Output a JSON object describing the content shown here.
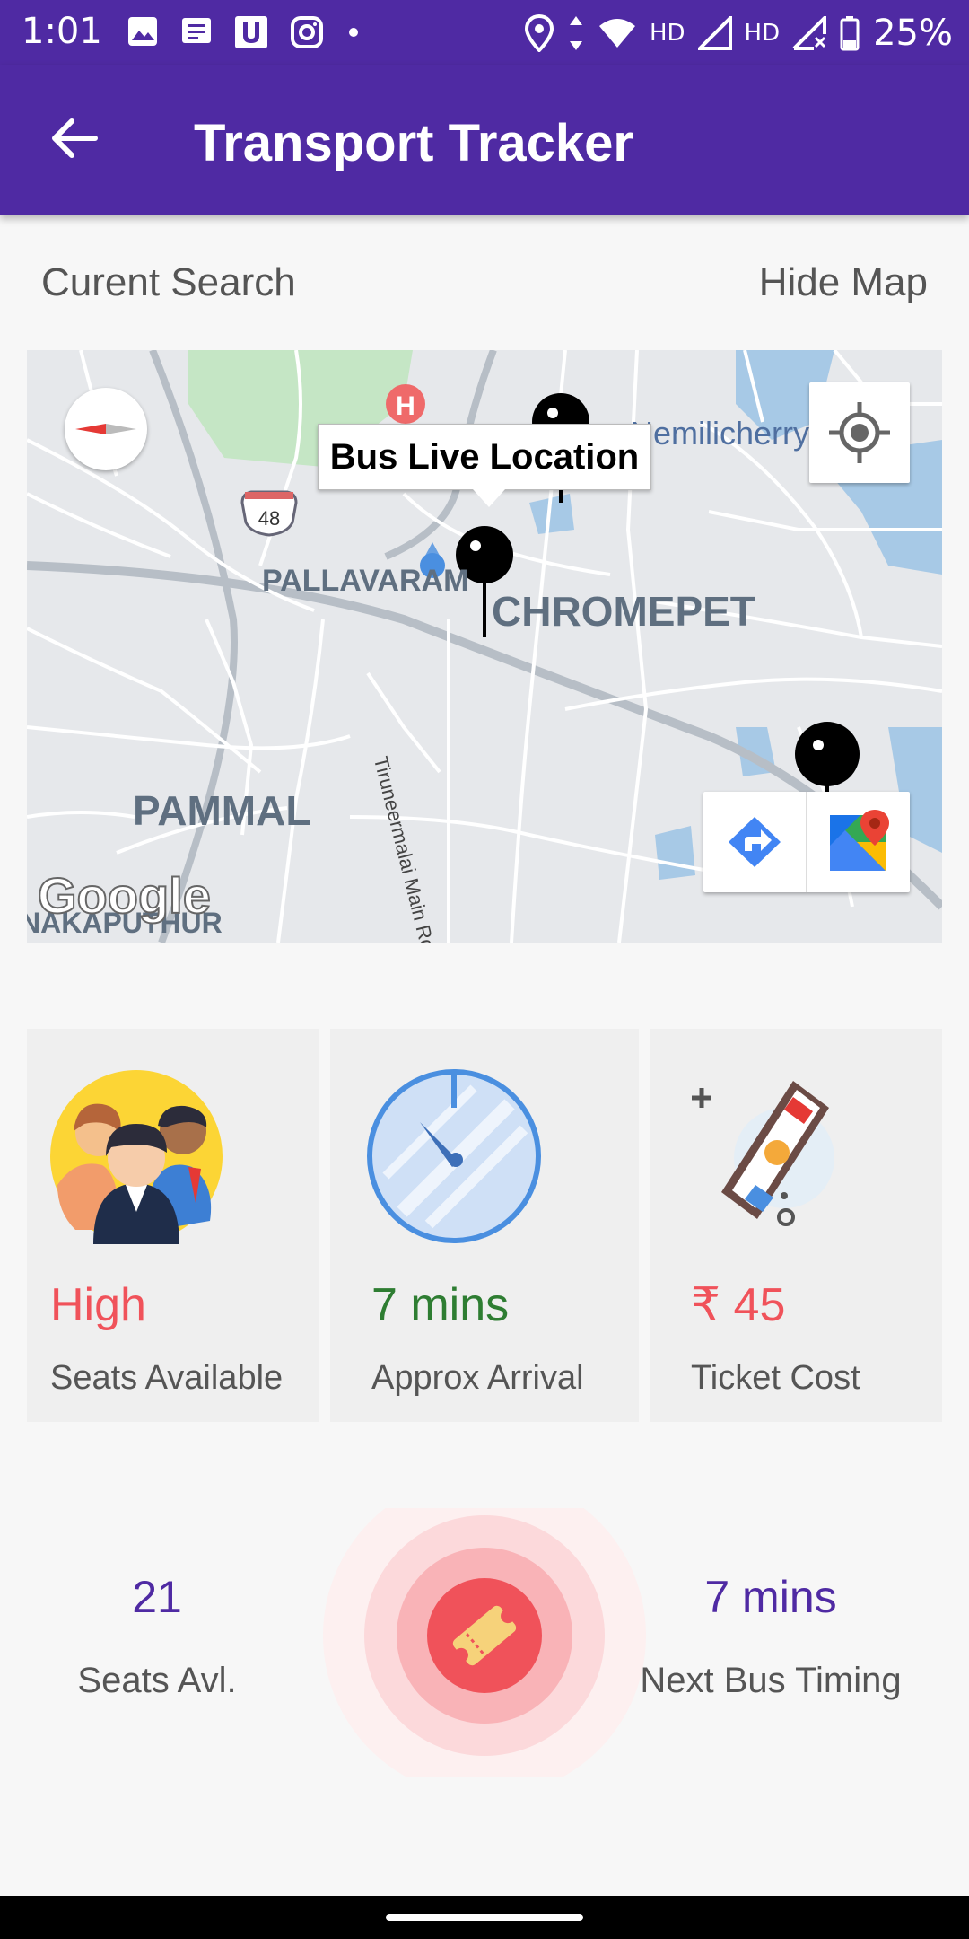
{
  "status_bar": {
    "time": "1:01",
    "battery": "25%",
    "network_labels": [
      "HD",
      "HD"
    ]
  },
  "app_bar": {
    "title": "Transport Tracker"
  },
  "search_row": {
    "label": "Curent Search",
    "toggle": "Hide Map"
  },
  "map": {
    "info_window": "Bus Live Location",
    "places": [
      "PALLAVARAM",
      "CHROMEPET",
      "PAMMAL",
      "Nemilicherry",
      "NAKAPUTHUR"
    ],
    "road_label": "Tiruneermalai Main Rd",
    "highway_shield": "48",
    "attribution": "Google"
  },
  "cards": [
    {
      "value": "High",
      "caption": "Seats Available",
      "value_color": "#f0525a"
    },
    {
      "value": "7 mins",
      "caption": "Approx Arrival",
      "value_color": "#2e7d32"
    },
    {
      "value": "₹ 45",
      "caption": "Ticket Cost",
      "value_color": "#f0525a"
    }
  ],
  "stats": {
    "seats": {
      "value": "21",
      "label": "Seats Avl."
    },
    "next_bus": {
      "value": "7 mins",
      "label": "Next Bus Timing"
    }
  },
  "colors": {
    "primary": "#4f2aa3",
    "accent": "#f0525a",
    "map_bg": "#e6e8eb",
    "water": "#a7c9e6",
    "park": "#c5e6c5"
  }
}
